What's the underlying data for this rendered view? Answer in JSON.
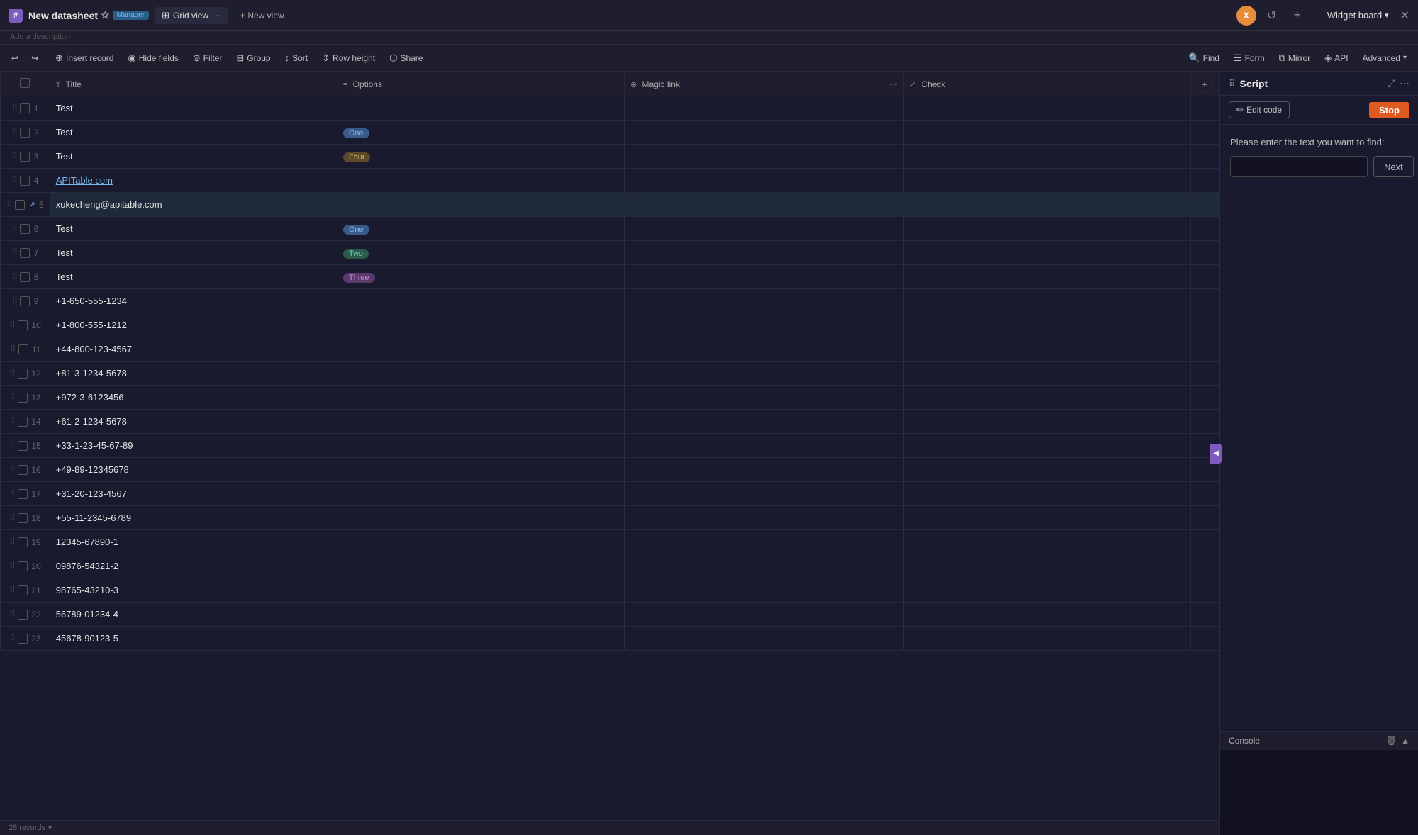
{
  "app": {
    "icon": "#",
    "title": "New datasheet",
    "star": "☆",
    "badge": "Manager",
    "description": "Add a description"
  },
  "views": {
    "grid_view": "Grid view",
    "new_view": "+ New view",
    "more_icon": "⋯"
  },
  "user": {
    "avatar_initial": "X",
    "avatar_color": "#e88c3a"
  },
  "widget_board": {
    "label": "Widget board",
    "chevron": "▾"
  },
  "toolbar": {
    "insert": "Insert record",
    "hide": "Hide fields",
    "filter": "Filter",
    "group": "Group",
    "sort": "Sort",
    "row_height": "Row height",
    "share": "Share",
    "find": "Find",
    "form": "Form",
    "mirror": "Mirror",
    "api": "API",
    "advanced": "Advanced",
    "advanced_chevron": "▾"
  },
  "table": {
    "columns": [
      {
        "id": "title",
        "icon": "T",
        "label": "Title"
      },
      {
        "id": "options",
        "icon": "≡",
        "label": "Options"
      },
      {
        "id": "magic_link",
        "icon": "⊕",
        "label": "Magic link",
        "has_more": true
      },
      {
        "id": "check",
        "icon": "✓",
        "label": "Check"
      }
    ],
    "rows": [
      {
        "num": 1,
        "title": "Test",
        "options": null,
        "magic_link": null,
        "check": null
      },
      {
        "num": 2,
        "title": "Test",
        "options": "One",
        "options_class": "tag-one",
        "magic_link": null,
        "check": null
      },
      {
        "num": 3,
        "title": "Test",
        "options": "Four",
        "options_class": "tag-four",
        "magic_link": null,
        "check": null
      },
      {
        "num": 4,
        "title": "APITable.com",
        "is_link": true,
        "options": null,
        "magic_link": null,
        "check": null
      },
      {
        "num": 5,
        "title": "xukecheng@apitable.com",
        "options": null,
        "magic_link": null,
        "check": null,
        "highlighted": true
      },
      {
        "num": 6,
        "title": "Test",
        "options": "One",
        "options_class": "tag-one",
        "magic_link": null,
        "check": null
      },
      {
        "num": 7,
        "title": "Test",
        "options": "Two",
        "options_class": "tag-two",
        "magic_link": null,
        "check": null
      },
      {
        "num": 8,
        "title": "Test",
        "options": "Three",
        "options_class": "tag-three",
        "magic_link": null,
        "check": null
      },
      {
        "num": 9,
        "title": "+1-650-555-1234",
        "options": null,
        "magic_link": null,
        "check": null
      },
      {
        "num": 10,
        "title": "+1-800-555-1212",
        "options": null,
        "magic_link": null,
        "check": null
      },
      {
        "num": 11,
        "title": "+44-800-123-4567",
        "options": null,
        "magic_link": null,
        "check": null
      },
      {
        "num": 12,
        "title": "+81-3-1234-5678",
        "options": null,
        "magic_link": null,
        "check": null
      },
      {
        "num": 13,
        "title": "+972-3-6123456",
        "options": null,
        "magic_link": null,
        "check": null
      },
      {
        "num": 14,
        "title": "+61-2-1234-5678",
        "options": null,
        "magic_link": null,
        "check": null
      },
      {
        "num": 15,
        "title": "+33-1-23-45-67-89",
        "options": null,
        "magic_link": null,
        "check": null
      },
      {
        "num": 16,
        "title": "+49-89-12345678",
        "options": null,
        "magic_link": null,
        "check": null
      },
      {
        "num": 17,
        "title": "+31-20-123-4567",
        "options": null,
        "magic_link": null,
        "check": null
      },
      {
        "num": 18,
        "title": "+55-11-2345-6789",
        "options": null,
        "magic_link": null,
        "check": null
      },
      {
        "num": 19,
        "title": "12345-67890-1",
        "options": null,
        "magic_link": null,
        "check": null
      },
      {
        "num": 20,
        "title": "09876-54321-2",
        "options": null,
        "magic_link": null,
        "check": null
      },
      {
        "num": 21,
        "title": "98765-43210-3",
        "options": null,
        "magic_link": null,
        "check": null
      },
      {
        "num": 22,
        "title": "56789-01234-4",
        "options": null,
        "magic_link": null,
        "check": null
      },
      {
        "num": 23,
        "title": "45678-90123-5",
        "options": null,
        "magic_link": null,
        "check": null
      }
    ],
    "footer_records": "28 records",
    "footer_chevron": "▾"
  },
  "script_panel": {
    "title": "Script",
    "edit_code_label": "Edit code",
    "stop_label": "Stop",
    "find_label": "Please enter the text you want to find:",
    "find_placeholder": "",
    "next_label": "Next",
    "console_label": "Console"
  }
}
